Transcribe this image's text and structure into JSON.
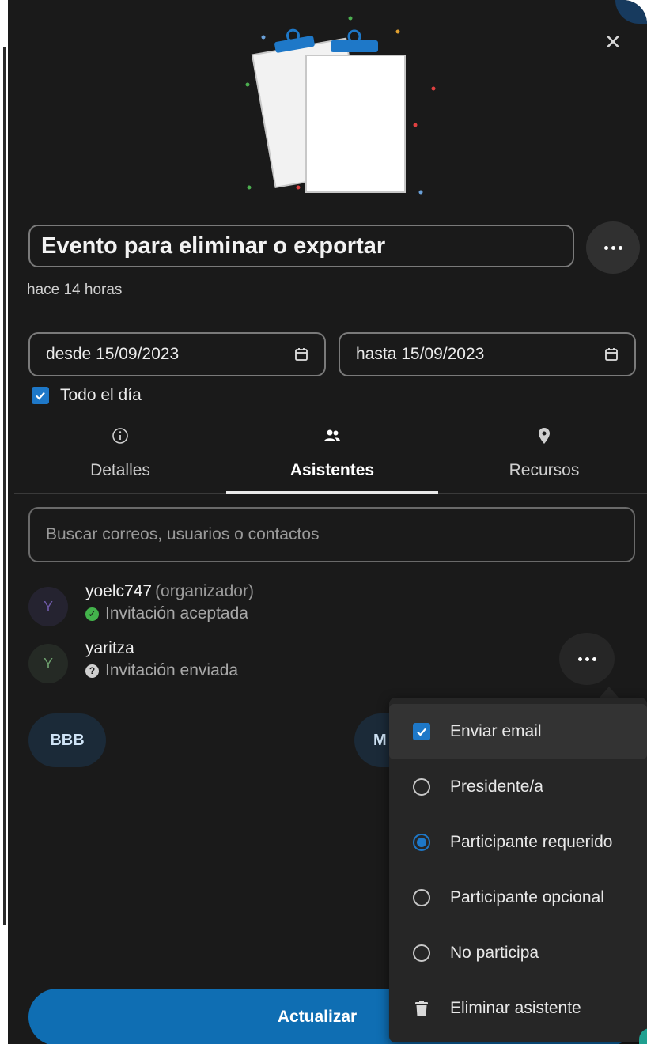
{
  "event": {
    "title": "Evento para eliminar o exportar",
    "timestamp": "hace 14 horas",
    "date_from": "desde 15/09/2023",
    "date_to": "hasta 15/09/2023",
    "all_day_label": "Todo el día",
    "all_day_checked": true
  },
  "icons": {
    "close": "close-icon",
    "more": "more-horizontal-icon",
    "calendar": "calendar-icon",
    "details": "info-icon",
    "attendees": "people-icon",
    "resources": "location-pin-icon",
    "accepted": "check-circle-icon",
    "pending": "question-circle-icon",
    "delete": "trash-icon"
  },
  "tabs": [
    {
      "label": "Detalles",
      "active": false
    },
    {
      "label": "Asistentes",
      "active": true
    },
    {
      "label": "Recursos",
      "active": false
    }
  ],
  "search": {
    "placeholder": "Buscar correos, usuarios o contactos"
  },
  "attendees": [
    {
      "initial": "Y",
      "name": "yoelc747",
      "role": "(organizador)",
      "status": "Invitación aceptada"
    },
    {
      "initial": "Y",
      "name": "yaritza",
      "status": "Invitación enviada"
    }
  ],
  "chips": [
    "BBB",
    "M"
  ],
  "context_menu": {
    "items": [
      {
        "label": "Enviar email",
        "control": "checkbox",
        "checked": true
      },
      {
        "label": "Presidente/a",
        "control": "radio",
        "checked": false
      },
      {
        "label": "Participante requerido",
        "control": "radio",
        "checked": true
      },
      {
        "label": "Participante opcional",
        "control": "radio",
        "checked": false
      },
      {
        "label": "No participa",
        "control": "radio",
        "checked": false
      },
      {
        "label": "Eliminar asistente",
        "control": "icon",
        "icon": "trash-icon"
      }
    ]
  },
  "footer": {
    "update_label": "Actualizar"
  },
  "colors": {
    "background": "#1a1a1a",
    "accent": "#1e78c8",
    "primary_button": "#0f6eb3",
    "success": "#43b34b"
  }
}
